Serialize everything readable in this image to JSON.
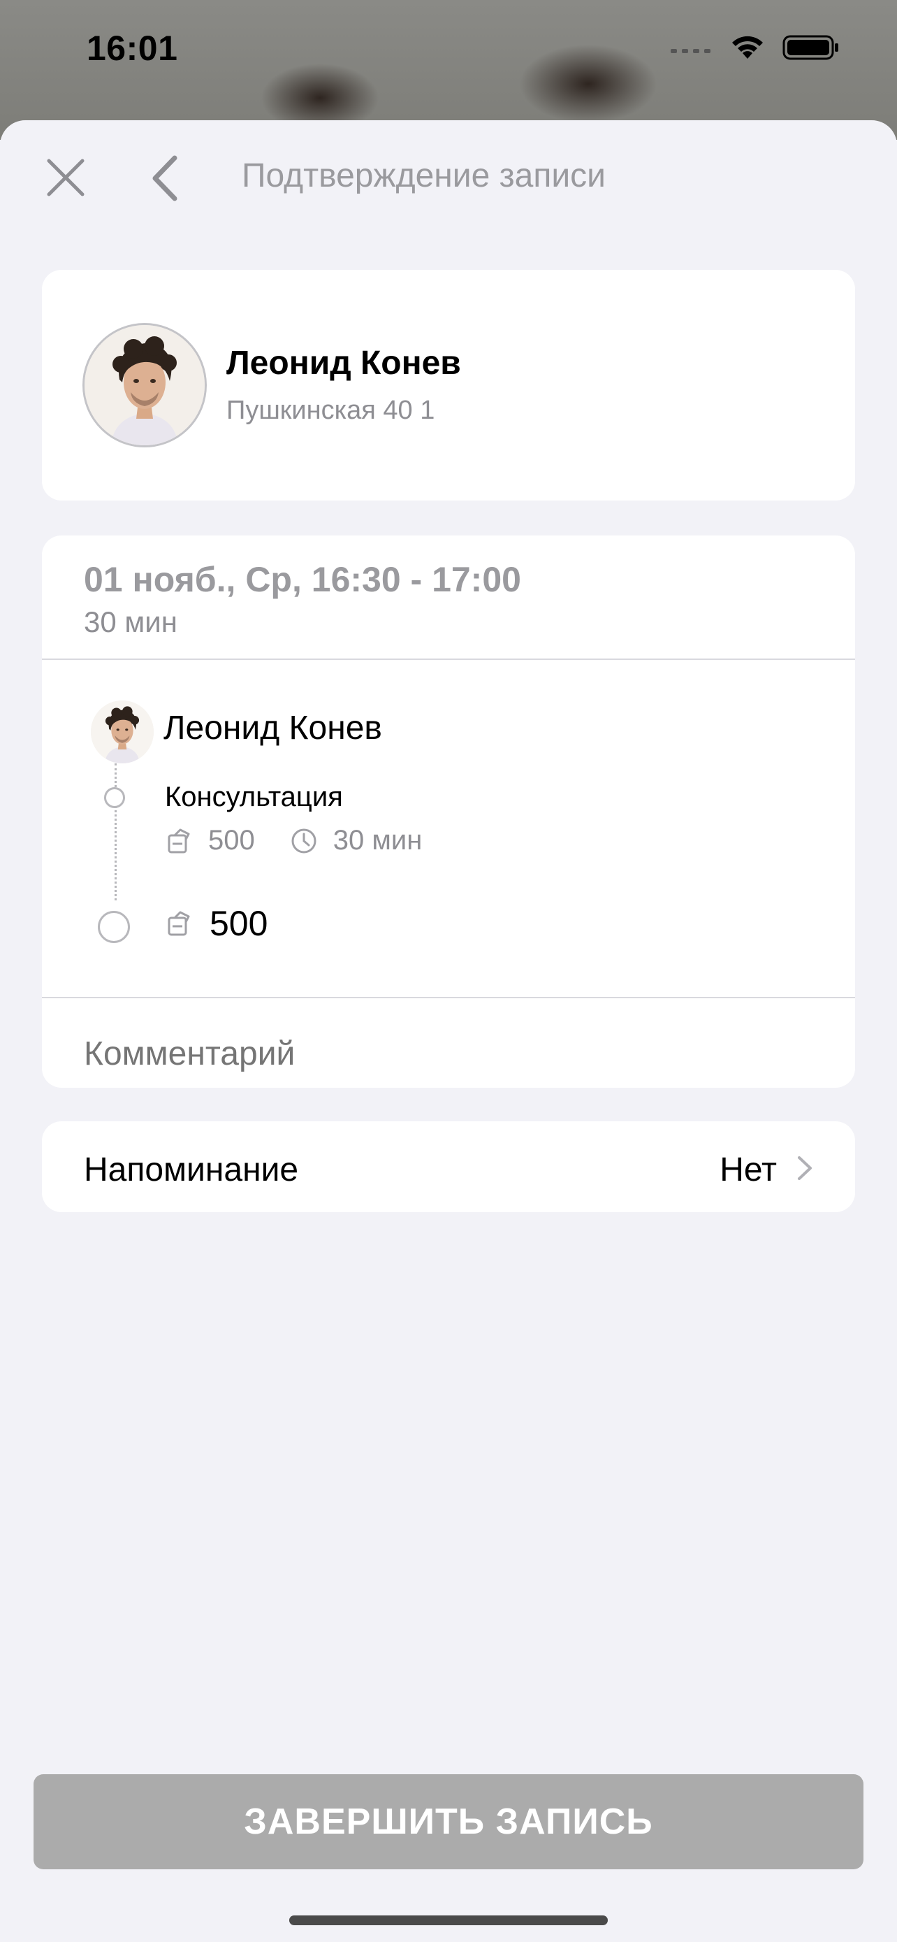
{
  "status_bar": {
    "time": "16:01"
  },
  "header": {
    "title": "Подтверждение записи",
    "close_icon": "close-icon",
    "back_icon": "chevron-left-icon"
  },
  "master": {
    "name": "Леонид Конев",
    "address": "Пушкинская 40 1"
  },
  "booking": {
    "datetime": "01 нояб., Ср, 16:30 - 17:00",
    "duration": "30 мин",
    "staff_name": "Леонид Конев",
    "service": {
      "name": "Консультация",
      "price": "500",
      "duration": "30 мин"
    },
    "total": "500",
    "comment_placeholder": "Комментарий"
  },
  "reminder": {
    "label": "Напоминание",
    "value": "Нет"
  },
  "actions": {
    "finish_label": "ЗАВЕРШИТЬ ЗАПИСЬ"
  },
  "colors": {
    "background": "#f2f2f7",
    "card": "#ffffff",
    "secondary_text": "#8e8e93",
    "disabled_button": "#ababab"
  }
}
